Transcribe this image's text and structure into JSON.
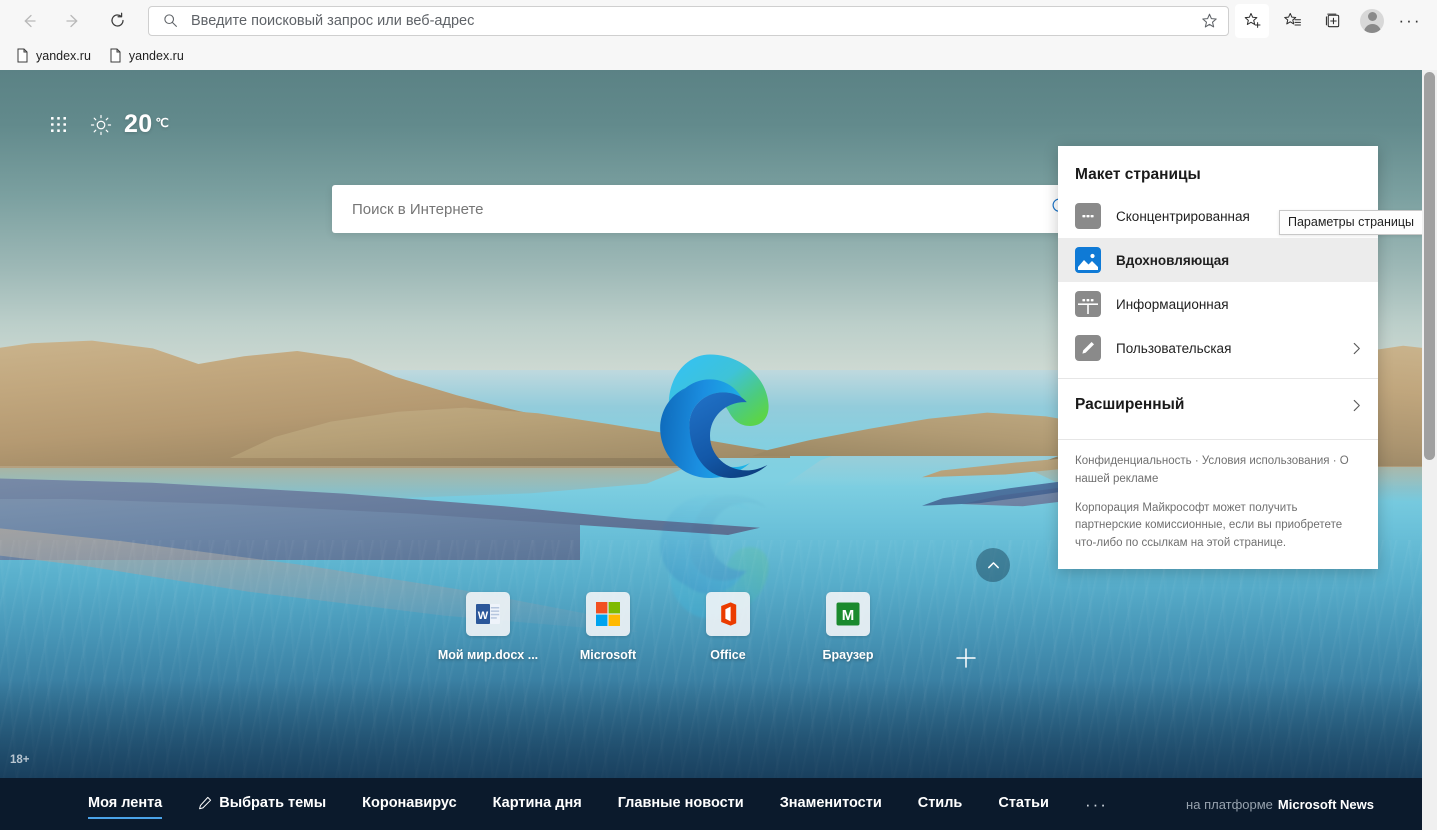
{
  "browser": {
    "nav": {
      "back_label": "Back",
      "forward_label": "Forward",
      "refresh_label": "Refresh"
    },
    "address_bar": {
      "placeholder": "Введите поисковый запрос или веб-адрес",
      "value": "",
      "search_icon": "search-icon",
      "favorite_icon": "star-outline-icon"
    },
    "toolbar_right": [
      {
        "name": "add-favorite-button",
        "icon": "star-plus-icon"
      },
      {
        "name": "favorites-hub-button",
        "icon": "star-list-icon"
      },
      {
        "name": "collections-button",
        "icon": "collections-plus-icon"
      },
      {
        "name": "profile-button",
        "icon": "person-avatar-icon"
      },
      {
        "name": "settings-and-more-button",
        "icon": "ellipsis-icon",
        "label": "…"
      }
    ],
    "bookmarks": [
      {
        "label": "yandex.ru",
        "icon": "page-icon"
      },
      {
        "label": "yandex.ru",
        "icon": "page-icon"
      }
    ]
  },
  "newtab": {
    "apps_grid_label": "Приложения",
    "weather": {
      "icon": "sun-icon",
      "temperature": "20",
      "unit": "℃"
    },
    "page_settings": {
      "icon": "gear-icon",
      "tooltip": "Параметры страницы"
    },
    "search": {
      "placeholder": "Поиск в Интернете",
      "value": "",
      "icon": "search-icon"
    },
    "logo": {
      "name": "microsoft-edge-logo"
    },
    "scroll_top_button": {
      "icon": "chevron-up-icon"
    },
    "tiles": [
      {
        "label": "Мой мир.docx ...",
        "icon": "word-doc-icon"
      },
      {
        "label": "Microsoft",
        "icon": "microsoft-logo-icon"
      },
      {
        "label": "Office",
        "icon": "office-logo-icon"
      },
      {
        "label": "Браузер",
        "icon": "mail-ru-browser-icon"
      }
    ],
    "add_tile": {
      "icon": "plus-icon",
      "label": "Добавить"
    },
    "age_rating": "18+",
    "news_nav": {
      "items": [
        {
          "label": "Моя лента",
          "active": true,
          "icon": null
        },
        {
          "label": "Выбрать темы",
          "active": false,
          "icon": "pencil-icon"
        },
        {
          "label": "Коронавирус",
          "active": false,
          "icon": null
        },
        {
          "label": "Картина дня",
          "active": false,
          "icon": null
        },
        {
          "label": "Главные новости",
          "active": false,
          "icon": null
        },
        {
          "label": "Знаменитости",
          "active": false,
          "icon": null
        },
        {
          "label": "Стиль",
          "active": false,
          "icon": null
        },
        {
          "label": "Статьи",
          "active": false,
          "icon": null
        }
      ],
      "more_label": "···",
      "platform_prefix": "на платформе",
      "platform_brand": "Microsoft News"
    }
  },
  "flyout": {
    "title": "Макет страницы",
    "options": [
      {
        "label": "Сконцентрированная",
        "icon": "focused-layout-icon",
        "selected": false,
        "has_chevron": false
      },
      {
        "label": "Вдохновляющая",
        "icon": "inspirational-layout-icon",
        "selected": true,
        "has_chevron": false
      },
      {
        "label": "Информационная",
        "icon": "informational-layout-icon",
        "selected": false,
        "has_chevron": false
      },
      {
        "label": "Пользовательская",
        "icon": "custom-layout-icon",
        "selected": false,
        "has_chevron": true
      }
    ],
    "advanced_label": "Расширенный",
    "advanced_chevron": "chevron-right-icon",
    "legal_links": "Конфиденциальность · Условия использования · О нашей рекламе",
    "legal_note": "Корпорация Майкрософт может получить партнерские комиссионные, если вы приобретете что-либо по ссылкам на этой странице."
  },
  "colors": {
    "accent_blue": "#0f7ad6",
    "news_bar_bg": "#0b1a2c",
    "active_underline": "#4aa3e8",
    "selected_row_bg": "#ececec"
  }
}
